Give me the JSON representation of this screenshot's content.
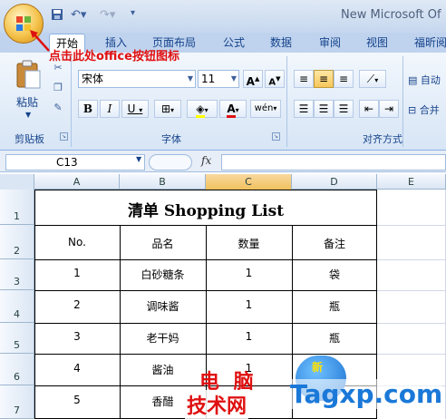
{
  "window": {
    "title": "New Microsoft Of"
  },
  "annotation": "点击此处office按钮图标",
  "tabs": [
    "开始",
    "插入",
    "页面布局",
    "公式",
    "数据",
    "审阅",
    "视图",
    "福昕阅"
  ],
  "ribbon": {
    "clipboard": {
      "label": "剪贴板",
      "paste": "粘贴"
    },
    "font": {
      "label": "字体",
      "font_name": "宋体",
      "font_size": "11",
      "bold": "B",
      "italic": "I",
      "underline": "U",
      "grow": "A",
      "shrink": "A",
      "font_color": "A",
      "phonetic": "wén"
    },
    "alignment": {
      "label": "对齐方式"
    },
    "extras": {
      "wrap": "自动",
      "merge": "合并"
    }
  },
  "formula_bar": {
    "name_box": "C13",
    "fx": "fx"
  },
  "columns": [
    "A",
    "B",
    "C",
    "D",
    "E"
  ],
  "selected_column": "C",
  "rows": [
    "1",
    "2",
    "3",
    "4",
    "5",
    "6",
    "7"
  ],
  "sheet": {
    "title": "清单 Shopping List",
    "headers": [
      "No.",
      "品名",
      "数量",
      "备注"
    ],
    "items": [
      {
        "no": "1",
        "name": "白砂糖条",
        "qty": "1",
        "note": "袋"
      },
      {
        "no": "2",
        "name": "调味酱",
        "qty": "1",
        "note": "瓶"
      },
      {
        "no": "3",
        "name": "老干妈",
        "qty": "1",
        "note": "瓶"
      },
      {
        "no": "4",
        "name": "酱油",
        "qty": "1",
        "note": ""
      },
      {
        "no": "5",
        "name": "香醋",
        "qty": "",
        "note": ""
      }
    ]
  },
  "watermark": {
    "cn_line1": "电 脑",
    "cn_line2": "技术网",
    "en": "Tagxp.com",
    "bubble": "新"
  },
  "colors": {
    "accent_red": "#e01010",
    "ribbon_blue": "#15428b",
    "selected_col": "#f1c15f"
  }
}
